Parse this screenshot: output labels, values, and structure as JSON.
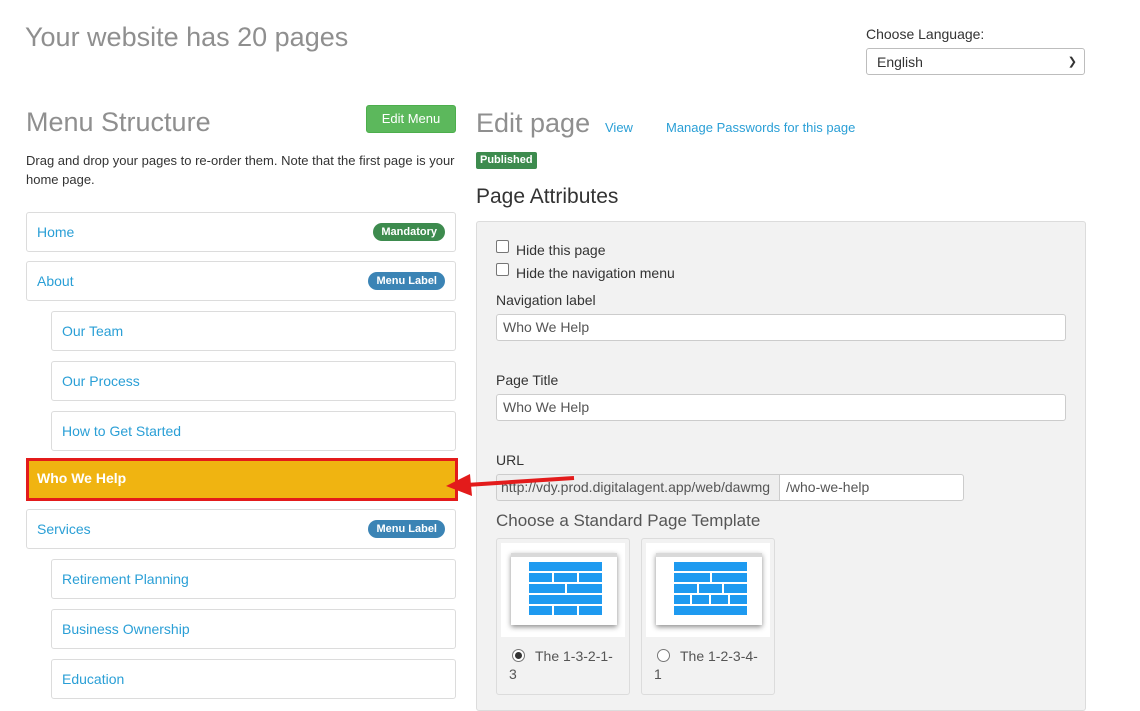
{
  "header": {
    "site_title": "Your website has 20 pages",
    "language_label": "Choose Language:",
    "language_value": "English"
  },
  "menu": {
    "title": "Menu Structure",
    "edit_button": "Edit Menu",
    "description": "Drag and drop your pages to re-order them. Note that the first page is your home page.",
    "items": [
      {
        "label": "Home",
        "badge": "Mandatory"
      },
      {
        "label": "About",
        "badge": "Menu Label"
      },
      {
        "label": "Our Team"
      },
      {
        "label": "Our Process"
      },
      {
        "label": "How to Get Started"
      },
      {
        "label": "Who We Help"
      },
      {
        "label": "Services",
        "badge": "Menu Label"
      },
      {
        "label": "Retirement Planning"
      },
      {
        "label": "Business Ownership"
      },
      {
        "label": "Education"
      }
    ]
  },
  "edit_page": {
    "title": "Edit page",
    "view_link": "View",
    "passwords_link": "Manage Passwords for this page",
    "status_badge": "Published",
    "attributes_title": "Page Attributes",
    "hide_page_label": "Hide this page",
    "hide_nav_label": "Hide the navigation menu",
    "nav_label_label": "Navigation label",
    "nav_label_value": "Who We Help",
    "page_title_label": "Page Title",
    "page_title_value": "Who We Help",
    "url_label": "URL",
    "url_prefix": "http://vdy.prod.digitalagent.app/web/dawmg",
    "url_slug": "/who-we-help",
    "template_heading": "Choose a Standard Page Template",
    "templates": [
      {
        "name": "The 1-3-2-1-3",
        "selected": true
      },
      {
        "name": "The 1-2-3-4-1",
        "selected": false
      }
    ]
  },
  "colors": {
    "accent_link": "#2a9fd6",
    "selected_bg": "#f0b411",
    "highlight_border": "#e31b1b",
    "success": "#5cb85c",
    "tile_blue": "#1e9af0"
  }
}
